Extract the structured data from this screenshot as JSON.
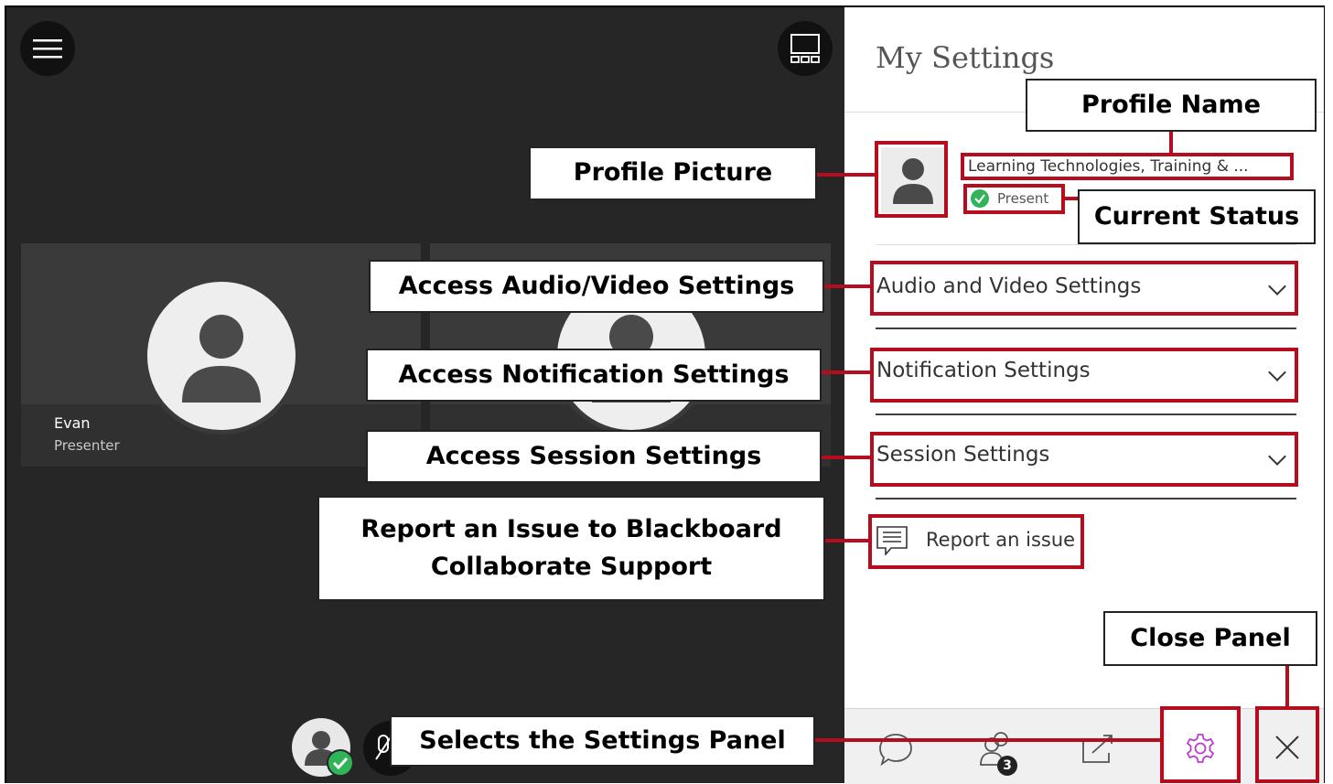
{
  "stage": {
    "menu_icon": "hamburger-menu-icon",
    "layout_icon": "layout-grid-icon",
    "tile": {
      "name": "Evan",
      "role": "Presenter"
    }
  },
  "panel": {
    "title": "My Settings",
    "profile": {
      "name": "Learning Technologies, Training & ...",
      "status": "Present"
    },
    "settings": [
      {
        "label": "Audio and Video Settings"
      },
      {
        "label": "Notification Settings"
      },
      {
        "label": "Session Settings"
      }
    ],
    "report_issue": "Report an issue",
    "footer": {
      "attendee_count": "3"
    }
  },
  "callouts": {
    "profile_name": "Profile Name",
    "profile_picture": "Profile Picture",
    "current_status": "Current Status",
    "audio_video": "Access Audio/Video Settings",
    "notifications": "Access Notification Settings",
    "session": "Access Session Settings",
    "report_line1": "Report an Issue to Blackboard",
    "report_line2": "Collaborate Support",
    "close_panel": "Close Panel",
    "settings_panel": "Selects the Settings Panel"
  },
  "colors": {
    "highlight": "#b50d1d",
    "status_green": "#2fb457",
    "settings_icon": "#b83fc9",
    "stage_bg": "#262626"
  }
}
